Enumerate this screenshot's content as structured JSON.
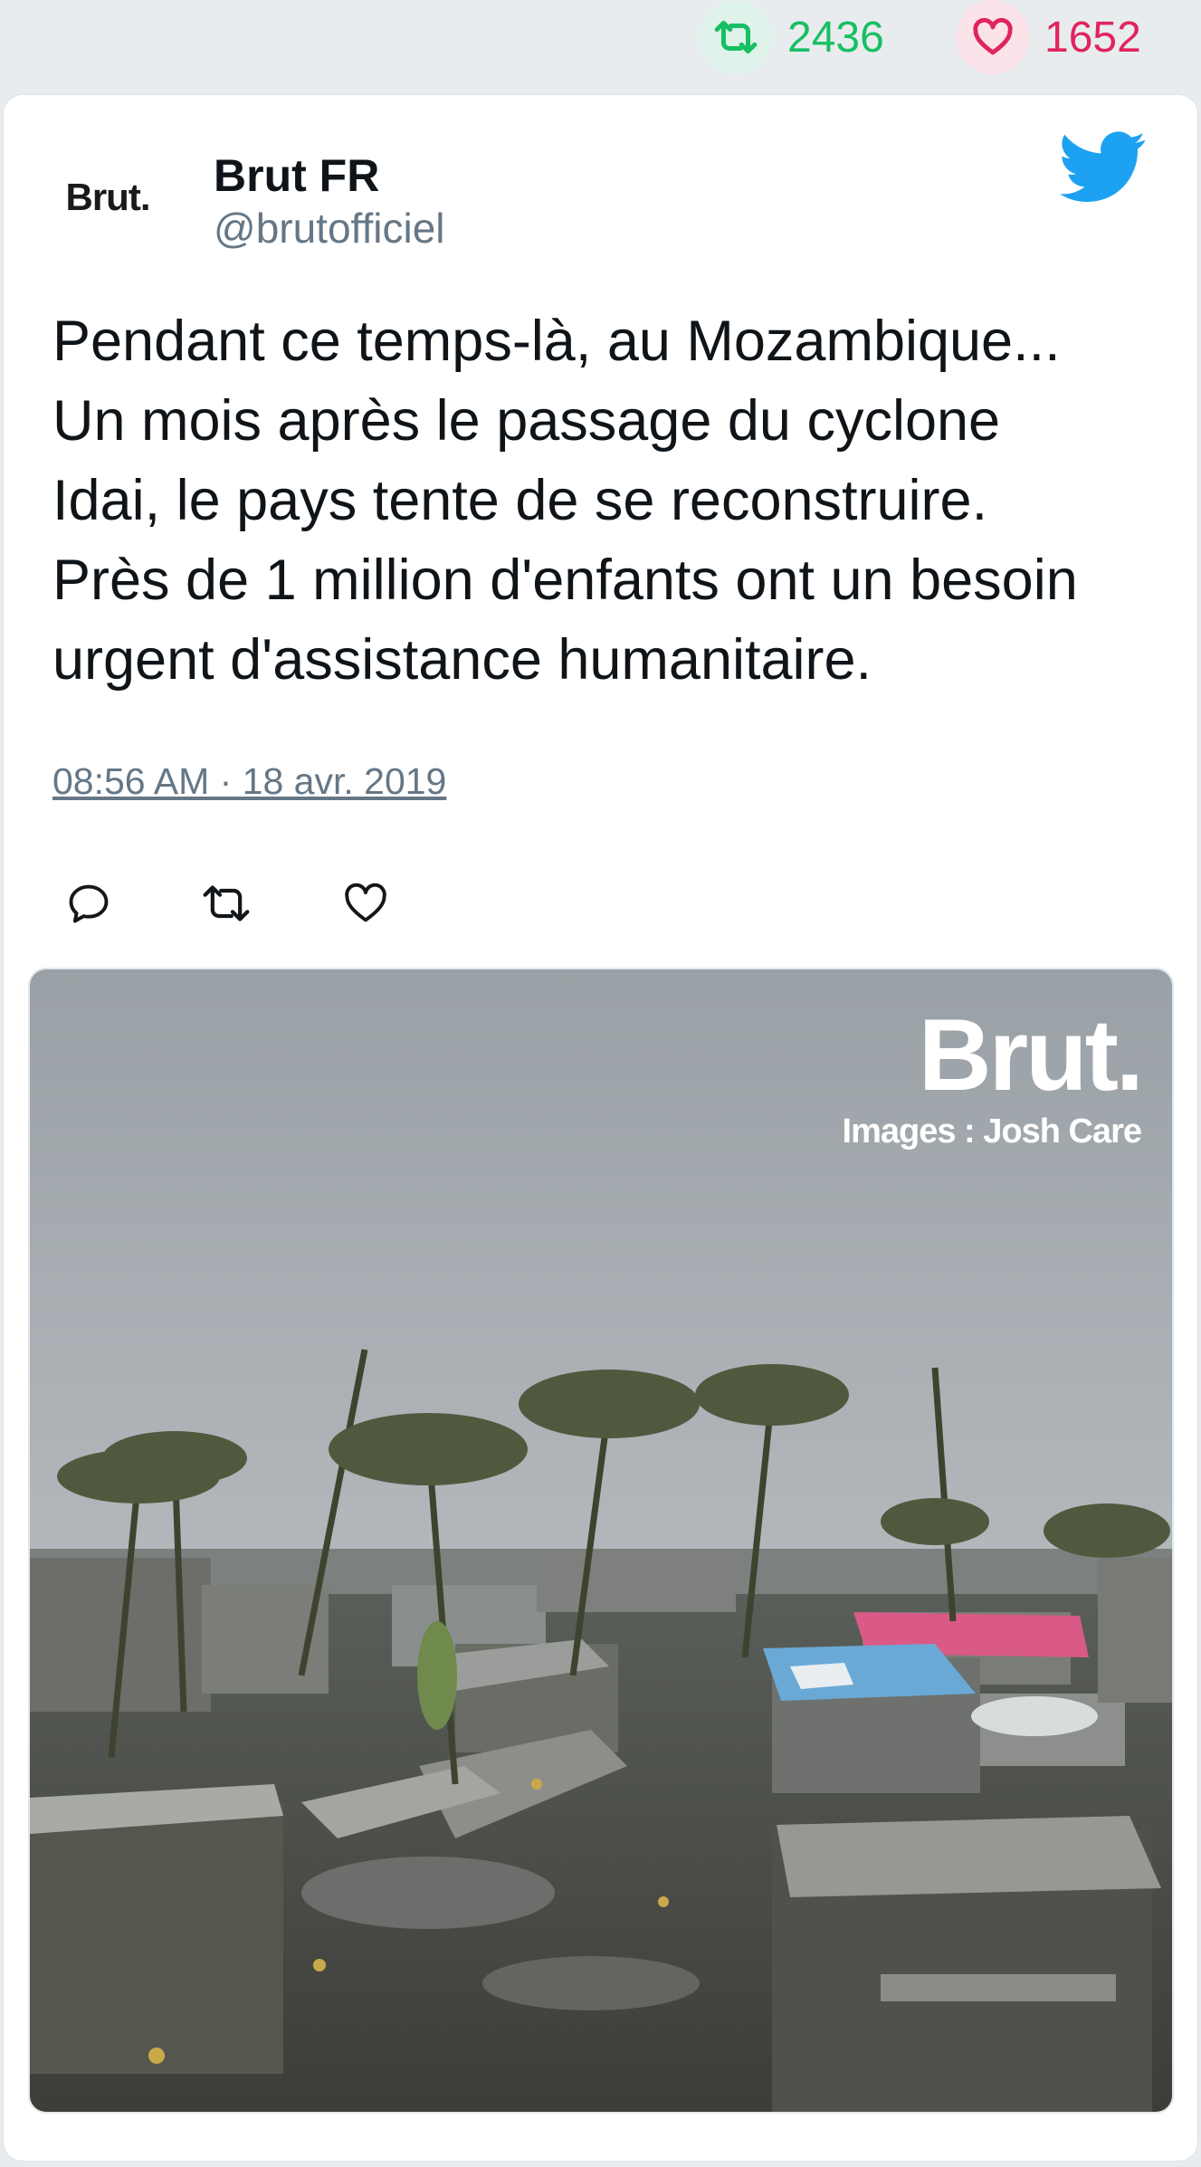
{
  "stats": {
    "retweet_count": "2436",
    "like_count": "1652",
    "retweet_icon": "retweet-icon",
    "like_icon": "heart-icon"
  },
  "tweet": {
    "avatar_text": "Brut.",
    "display_name": "Brut FR",
    "handle": "@brutofficiel",
    "text_lines": [
      "Pendant ce temps-là, au Mozambique...",
      "Un mois après le passage du cyclone",
      "Idai, le pays tente de se reconstruire.",
      "Près de 1 million d'enfants ont un besoin",
      "urgent d'assistance humanitaire."
    ],
    "timestamp": "08:56 AM · 18 avr. 2019",
    "brand_icon": "twitter-bird-icon",
    "actions": [
      "reply-icon",
      "retweet-icon",
      "like-icon"
    ]
  },
  "media": {
    "watermark_brand": "Brut.",
    "watermark_credit": "Images : Josh Care"
  },
  "colors": {
    "retweet": "#17bf63",
    "like": "#e0245e",
    "twitter_blue": "#1da1f2",
    "muted": "#657786",
    "background": "#e9ecef"
  }
}
